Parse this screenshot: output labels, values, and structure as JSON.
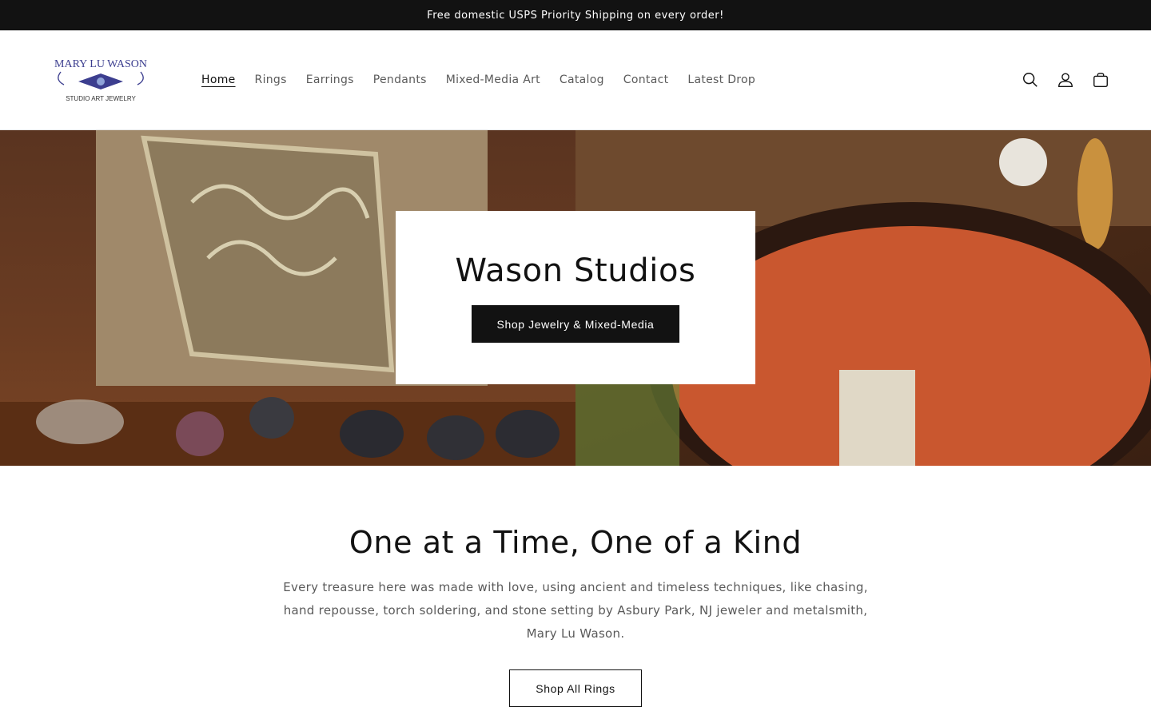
{
  "announcement": "Free domestic USPS Priority Shipping on every order!",
  "logo": {
    "name": "MARY LU WASON",
    "tagline": "STUDIO ART JEWELRY"
  },
  "nav": [
    {
      "label": "Home"
    },
    {
      "label": "Rings"
    },
    {
      "label": "Earrings"
    },
    {
      "label": "Pendants"
    },
    {
      "label": "Mixed-Media Art"
    },
    {
      "label": "Catalog"
    },
    {
      "label": "Contact"
    },
    {
      "label": "Latest Drop"
    }
  ],
  "header_icons": [
    "search-icon",
    "account-icon",
    "cart-icon"
  ],
  "hero": {
    "title": "Wason Studios",
    "button": "Shop Jewelry & Mixed-Media"
  },
  "intro": {
    "title": "One at a Time, One of a Kind",
    "text": "Every treasure here was made with love, using ancient and timeless techniques, like chasing, hand repousse, torch soldering, and stone setting by Asbury Park, NJ jeweler and metalsmith, Mary Lu Wason.",
    "button": "Shop All Rings"
  },
  "colors": {
    "dark": "#121212",
    "muted": "#5a5a5a",
    "logo_blue": "#3c3e8f"
  }
}
